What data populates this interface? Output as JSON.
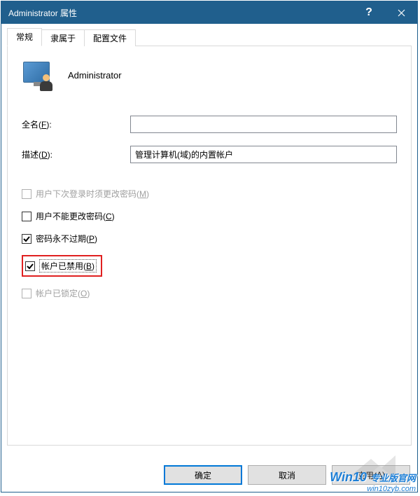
{
  "titlebar": {
    "title": "Administrator 属性",
    "help": "?",
    "close": "×"
  },
  "tabs": [
    {
      "label": "常规",
      "active": true
    },
    {
      "label": "隶属于",
      "active": false
    },
    {
      "label": "配置文件",
      "active": false
    }
  ],
  "header": {
    "username": "Administrator"
  },
  "fields": {
    "fullname": {
      "label_prefix": "全名(",
      "hotkey": "F",
      "label_suffix": "):",
      "value": ""
    },
    "description": {
      "label_prefix": "描述(",
      "hotkey": "D",
      "label_suffix": "):",
      "value": "管理计算机(域)的内置帐户"
    }
  },
  "checkboxes": {
    "must_change": {
      "label_prefix": "用户下次登录时须更改密码(",
      "hotkey": "M",
      "label_suffix": ")",
      "checked": false,
      "disabled": true
    },
    "cannot_change": {
      "label_prefix": "用户不能更改密码(",
      "hotkey": "C",
      "label_suffix": ")",
      "checked": false,
      "disabled": false
    },
    "never_expires": {
      "label_prefix": "密码永不过期(",
      "hotkey": "P",
      "label_suffix": ")",
      "checked": true,
      "disabled": false
    },
    "disabled_account": {
      "label_prefix": "帐户已禁用(",
      "hotkey": "B",
      "label_suffix": ")",
      "checked": true,
      "disabled": false,
      "highlighted": true
    },
    "locked": {
      "label_prefix": "帐户已锁定(",
      "hotkey": "O",
      "label_suffix": ")",
      "checked": false,
      "disabled": true
    }
  },
  "buttons": {
    "ok": "确定",
    "cancel": "取消",
    "apply_prefix": "应用(",
    "apply_hotkey": "A",
    "apply_suffix": ")"
  },
  "watermark": {
    "main": "Win10",
    "sub": "专业版官网",
    "url": "win10zyb.com"
  }
}
